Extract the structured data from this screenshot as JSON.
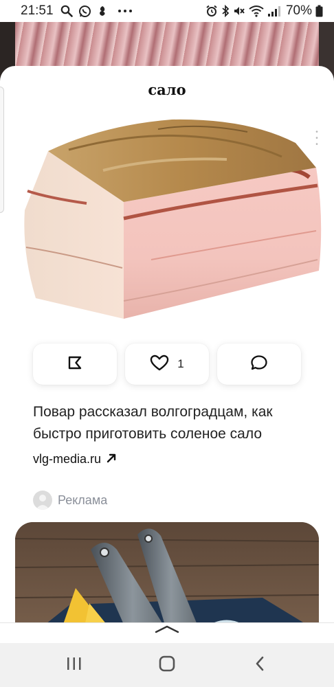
{
  "status_bar": {
    "time": "21:51",
    "battery": "70%",
    "left_icons": [
      "search-icon",
      "whatsapp-icon",
      "app-notification-icon",
      "more-notifications-icon"
    ],
    "right_icons": [
      "alarm-icon",
      "bluetooth-icon",
      "mute-icon",
      "wifi-icon",
      "signal-icon",
      "battery-icon"
    ]
  },
  "sheet": {
    "title": "сало"
  },
  "actions": {
    "bookmark_icon": "bookmark-icon",
    "like_count": "1",
    "comment_icon": "comment-icon"
  },
  "article": {
    "title": "Повар рассказал волгоградцам, как быстро приготовить соленое сало",
    "source": "vlg-media.ru"
  },
  "ad": {
    "label": "Реклама"
  },
  "colors": {
    "text": "#222222",
    "muted": "#8a8f99",
    "nav_bg": "#f1f1f1"
  }
}
